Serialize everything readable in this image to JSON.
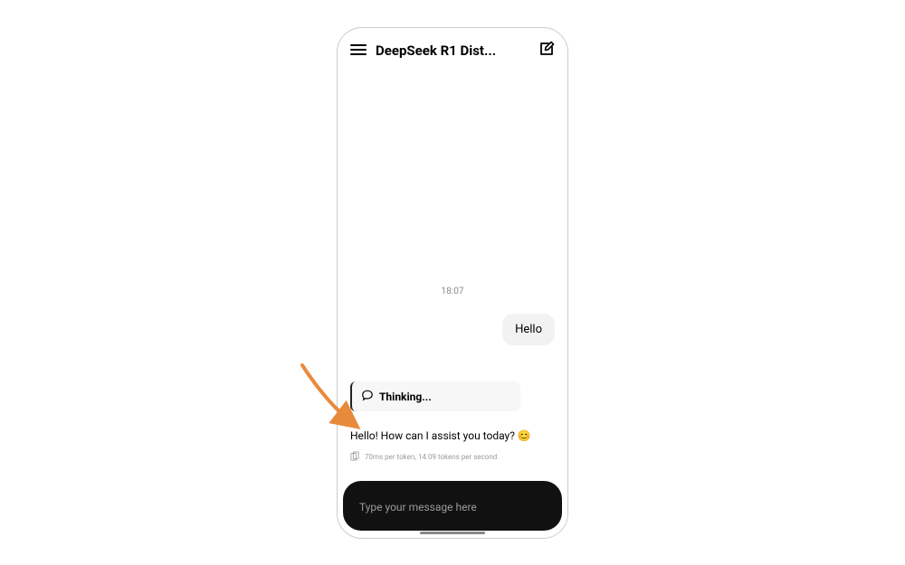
{
  "header": {
    "title": "DeepSeek R1 Dist...",
    "menu_icon": "hamburger-icon",
    "compose_icon": "compose-icon"
  },
  "chat": {
    "timestamp": "18:07",
    "user_message": "Hello",
    "thinking_label": "Thinking...",
    "assistant_message": "Hello! How can I assist you today? 😊",
    "meta_text": "70ms per token, 14.09 tokens per second"
  },
  "input": {
    "placeholder": "Type your message here"
  },
  "annotation": {
    "arrow_color": "#e88a3c"
  }
}
